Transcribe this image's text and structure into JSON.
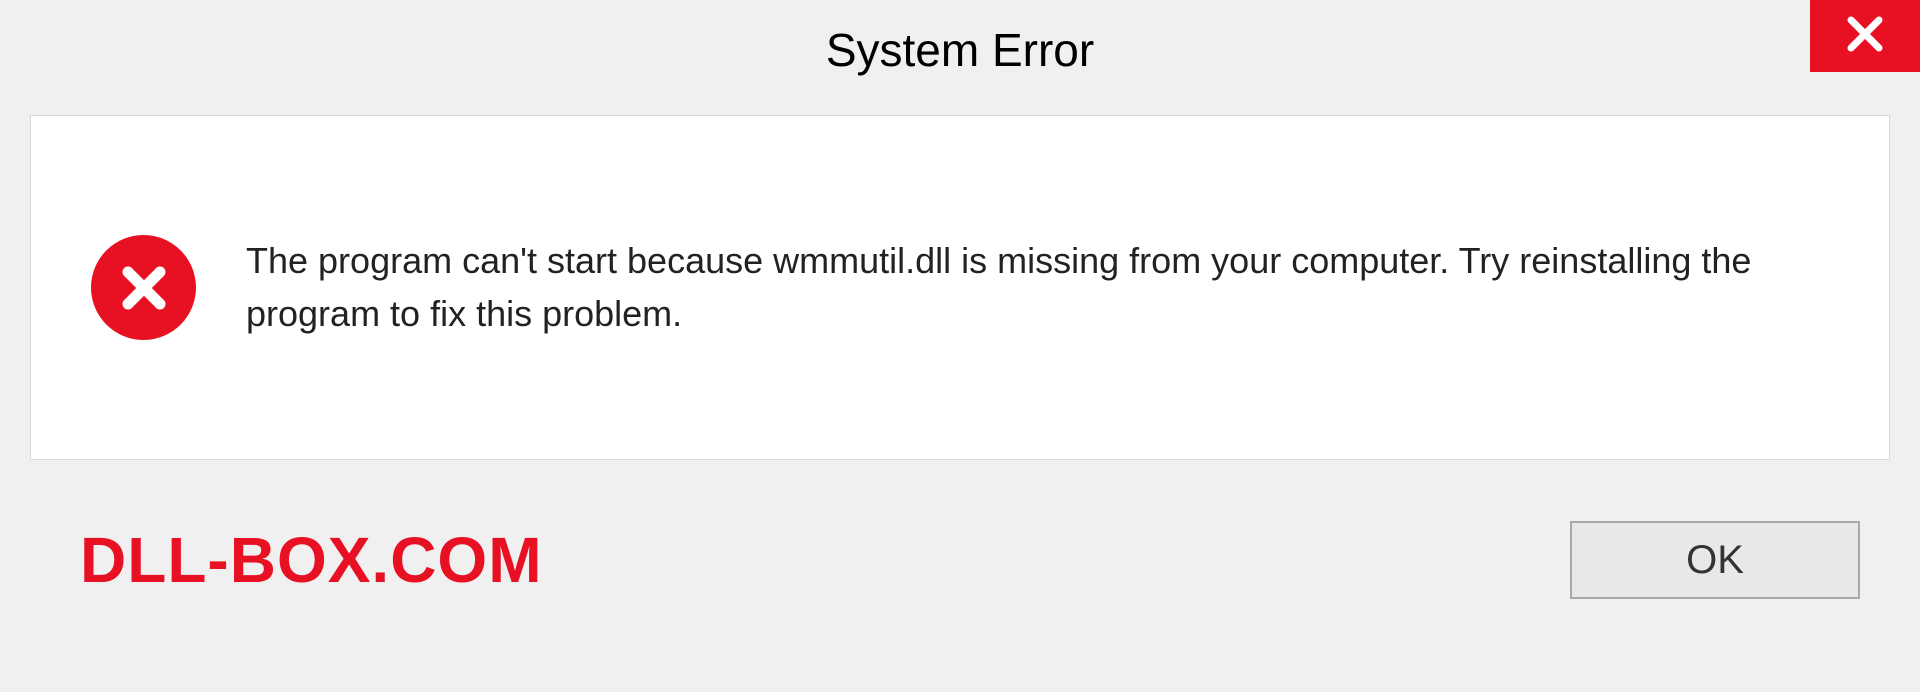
{
  "dialog": {
    "title": "System Error",
    "message": "The program can't start because wmmutil.dll is missing from your computer. Try reinstalling the program to fix this problem.",
    "ok_label": "OK"
  },
  "watermark": "DLL-BOX.COM",
  "colors": {
    "error_red": "#e81123",
    "panel_bg": "#ffffff",
    "body_bg": "#f0f0f0"
  }
}
